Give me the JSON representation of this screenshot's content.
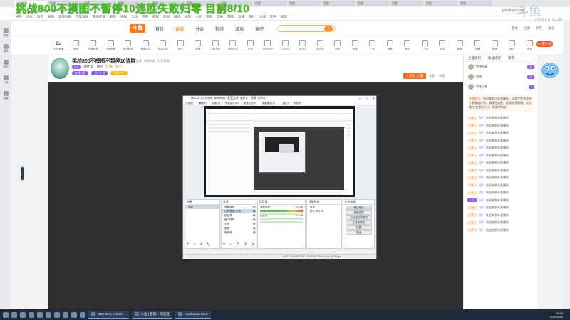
{
  "overlay": {
    "title": "挑战800不摸图不暂停10连胜失败归零 目前8/10"
  },
  "watermark": {
    "main": "斗鱼",
    "sub": "DOUYU.COM"
  },
  "browser": {
    "tabs": [
      "斗鱼直播",
      "页面",
      "页面",
      "页面",
      "页面",
      "页面",
      "页面",
      "页面",
      "页面",
      "页面",
      "页面",
      "页面",
      "页面",
      "页面"
    ],
    "url": "https://www.douyu.com",
    "addr_right": "上海即登云大楼 ..."
  },
  "bookmarks": [
    "书签",
    "优化",
    "淘宝",
    "商城",
    "高德地图",
    "百度地图",
    "我的店铺",
    "翻译",
    "天猫",
    "活动",
    "京东",
    "教程",
    "新闻",
    "微博",
    "视频",
    "小说",
    "资讯",
    "音乐",
    "游戏",
    "直播",
    "图片",
    "论坛",
    "软件",
    "阅读"
  ],
  "left_sidebar": {
    "items": [
      "导航",
      "推荐",
      "我的",
      "分类",
      "直播"
    ]
  },
  "header": {
    "logo": "斗鱼",
    "nav": [
      "首页",
      "直播",
      "分类",
      "视频",
      "游戏",
      "鱼吧"
    ],
    "right_links": [
      "登录",
      "注册",
      "历史",
      "关注"
    ]
  },
  "category_row": {
    "first_num": "12",
    "first_label": "正在直播",
    "items": [
      "推荐",
      "英雄联盟",
      "王者荣耀",
      "和平精英",
      "绝地求生",
      "穿越火线",
      "DNF",
      "原神",
      "主机游戏",
      "单机热游",
      "逆战",
      "永劫无间",
      "CSGO",
      "APEX",
      "lol手游",
      "星秀",
      "颜值",
      "户外",
      "美食",
      "音乐",
      "二次元",
      "科技",
      "体育",
      "卡牌",
      "棋牌",
      "娱乐",
      "更多"
    ],
    "pc_badge": "PC客户端"
  },
  "streamer": {
    "title": "挑战800不摸图不暂停10连胜",
    "meta": "· 主播 · 单机热游 · 红色警戒",
    "level": "Lv.1",
    "name": "战胜 哥",
    "fans": "粉丝 ",
    "rank": "红警 · 热门",
    "tags": [
      "红警大佬",
      "冠军主播",
      "红警专家"
    ],
    "follow": "+ 关注 主播",
    "actions": [
      "分享",
      "举报"
    ]
  },
  "obs": {
    "title": "OBS 28.1.1 (64 bit, windows) - 配置文件: 未命名 - 场景: 未命名",
    "menu": [
      "文件(F)",
      "编辑(E)",
      "视图(V)",
      "停靠部件(D)",
      "配置文件(P)",
      "场景集合(S)",
      "工具(T)",
      "帮助(H)"
    ],
    "win_buttons": [
      "—",
      "□",
      "✕"
    ],
    "docks": {
      "scenes": {
        "header": "场景",
        "items": [
          "场景"
        ]
      },
      "sources": {
        "header": "来源",
        "items": [
          "屏幕捕获",
          "红色警戒2游戏",
          "颜色源",
          "窗口捕获",
          "文本",
          "图像",
          "媒体源"
        ]
      },
      "mixer": {
        "header": "混音器",
        "channels": [
          {
            "label": "桌面音频",
            "value": "0.0 dB"
          },
          {
            "label": "麦克风",
            "value": "0.0 dB"
          }
        ]
      },
      "transitions": {
        "header": "场景转场",
        "items": [
          "淡出",
          "时长 300 ms"
        ]
      },
      "controls": {
        "header": "控制按钮",
        "buttons": [
          "停止推流",
          "开始录制",
          "启动虚拟摄像机",
          "工作室模式",
          "设置",
          "退出"
        ]
      }
    },
    "status": "LIVE: 00:00:00   REC: 00:00:00   CPU: 5.4%, 60.00 fps"
  },
  "chat": {
    "tabs": [
      "主播排行",
      "粉丝排行",
      "贵宾"
    ],
    "rank": [
      {
        "name": "梦想成真",
        "badge": "12"
      },
      {
        "name": "战神",
        "badge": "10"
      },
      {
        "name": "荣耀王者",
        "badge": "8"
      }
    ],
    "notice_title": "系统提示：",
    "notice_body": "欢迎来到斗鱼直播间，斗鱼严禁未成年人直播或打赏，请理性消费，提倡文明直播，若主播存在违规行为，请及时举报。",
    "messages": [
      {
        "badge": "12",
        "user": "用户",
        "text": "欢迎来到本直播间"
      },
      {
        "badge": "8",
        "user": "用户",
        "text": "欢迎来到本直播间"
      },
      {
        "badge": "7",
        "user": "用户",
        "text": "欢迎来到本直播间"
      },
      {
        "badge": "6",
        "user": "用户",
        "text": "欢迎来到本直播间"
      },
      {
        "badge": "9",
        "user": "用户",
        "text": "欢迎来到本直播间"
      },
      {
        "badge": "5",
        "user": "用户",
        "text": "欢迎来到本直播间"
      },
      {
        "badge": "4",
        "user": "用户",
        "text": "欢迎来到本直播间"
      },
      {
        "badge": "11",
        "user": "用户",
        "text": "欢迎来到本直播间"
      },
      {
        "badge": "3",
        "user": "用户",
        "text": "欢迎来到本直播间"
      },
      {
        "badge": "6",
        "user": "用户",
        "text": "欢迎来到本直播间"
      },
      {
        "badge": "2",
        "user": "用户",
        "text": "欢迎来到本直播间"
      },
      {
        "badge": "8",
        "user": "用户",
        "text": "欢迎来到本直播间"
      },
      {
        "badge": "10",
        "user": "用户",
        "text": "欢迎来到本直播间"
      },
      {
        "badge": "9",
        "user": "用户",
        "text": "欢迎来到本直播间"
      },
      {
        "badge": "5",
        "user": "用户",
        "text": "欢迎来到本直播间"
      },
      {
        "badge": "7",
        "user": "用户",
        "text": "欢迎来到本直播间"
      }
    ]
  },
  "taskbar": {
    "apps": [
      "OBS 28.1.1 (64 bi...",
      "斗鱼 | 直播... 浏览器",
      "Application Error"
    ],
    "time": "19:50",
    "date": "2022/4/29"
  },
  "colors": {
    "accent": "#ff6a00",
    "overlay_green": "#46c21a",
    "player_bg": "#2e2f31",
    "taskbar_bg": "#1f2a3a"
  }
}
